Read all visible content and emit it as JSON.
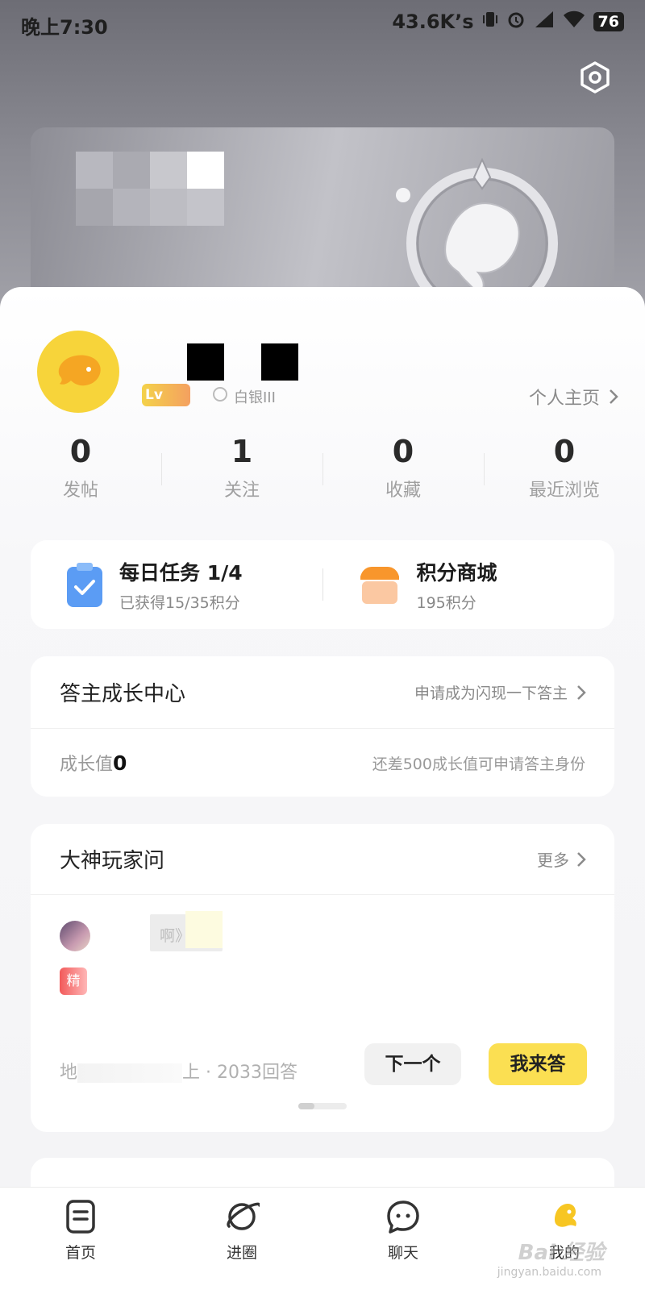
{
  "status_bar": {
    "time": "晚上7:30",
    "network_speed": "43.6K’s",
    "battery": "76"
  },
  "profile": {
    "level_label": "Lv",
    "rank": "白银III",
    "homepage_link": "个人主页"
  },
  "stats": [
    {
      "value": "0",
      "label": "发帖"
    },
    {
      "value": "1",
      "label": "关注"
    },
    {
      "value": "0",
      "label": "收藏"
    },
    {
      "value": "0",
      "label": "最近浏览"
    }
  ],
  "tasks": {
    "daily_title": "每日任务 1/4",
    "daily_sub": "已获得15/35积分",
    "mall_title": "积分商城",
    "mall_sub": "195积分"
  },
  "growth": {
    "title": "答主成长中心",
    "apply_link": "申请成为闪现一下答主",
    "value_label": "成长值",
    "value": "0",
    "hint": "还差500成长值可申请答主身份"
  },
  "qa": {
    "title": "大神玩家问",
    "more": "更多",
    "question_fragment": "啊》",
    "tag": "精",
    "meta_prefix": "地",
    "meta_suffix": "上 · 2033回答",
    "next_button": "下一个",
    "answer_button": "我来答"
  },
  "tabbar": [
    {
      "label": "首页",
      "icon": "document-icon"
    },
    {
      "label": "进圈",
      "icon": "planet-icon"
    },
    {
      "label": "聊天",
      "icon": "chat-bubble-icon"
    },
    {
      "label": "我的",
      "icon": "mascot-icon"
    }
  ],
  "watermark": {
    "brand": "Bai 经验",
    "url": "jingyan.baidu.com"
  },
  "colors": {
    "accent_yellow": "#fbdf52",
    "avatar_yellow": "#f7d43a"
  }
}
